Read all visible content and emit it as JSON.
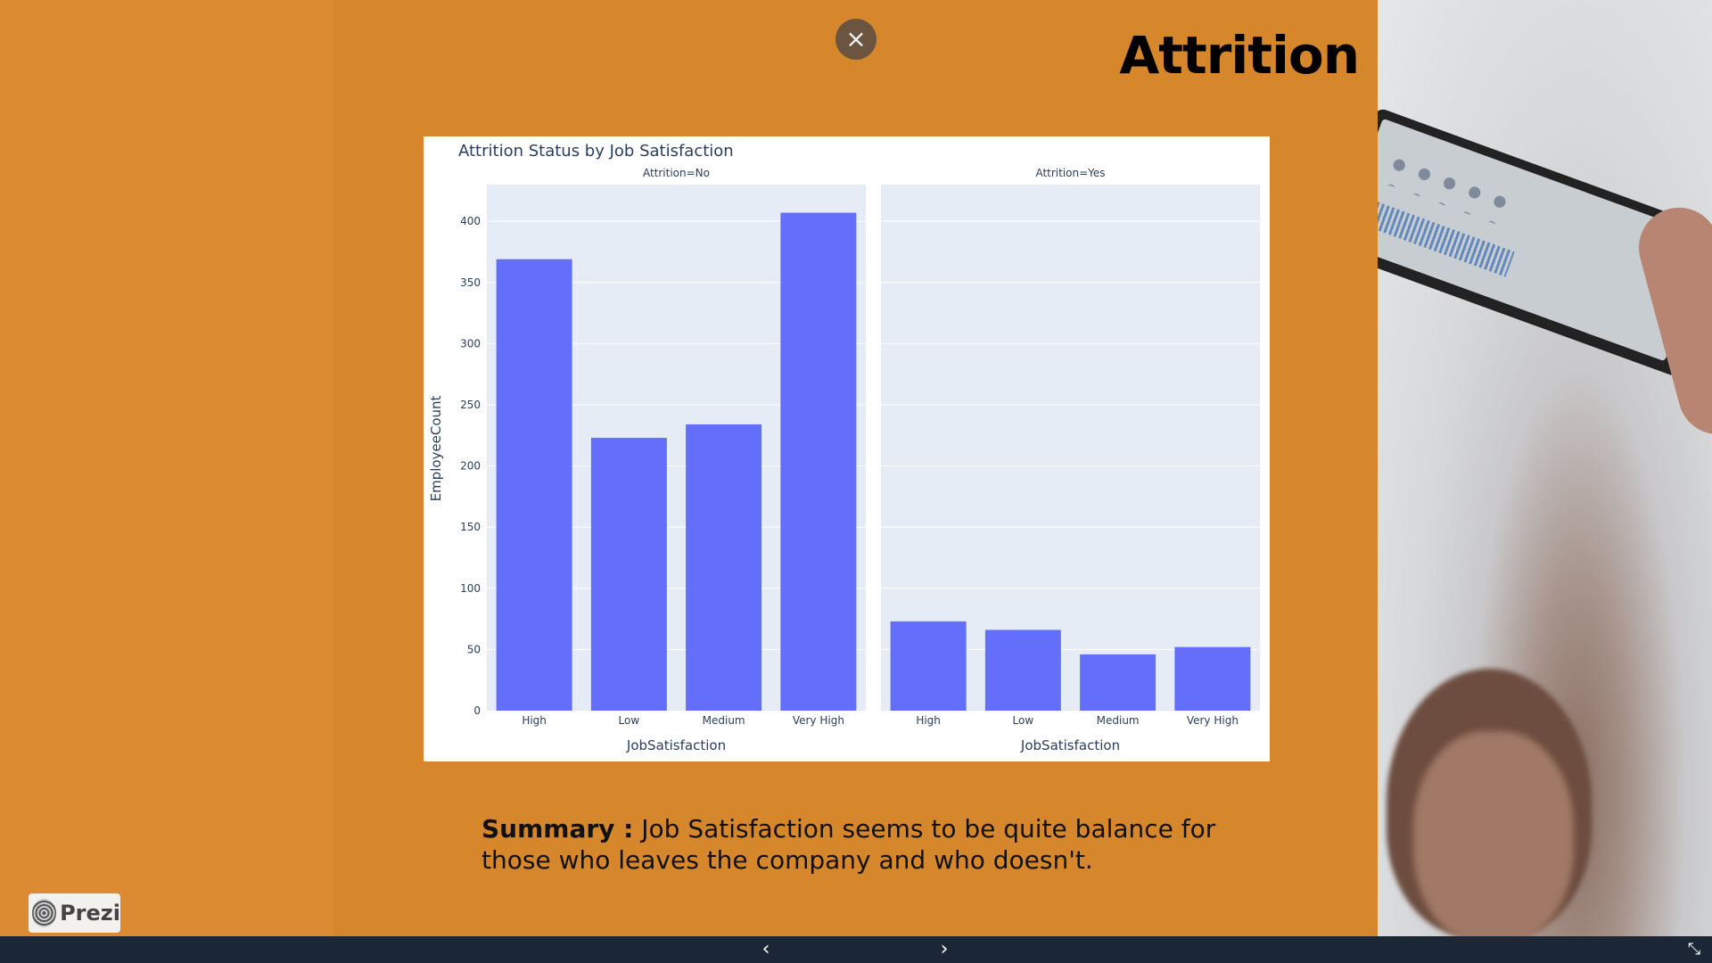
{
  "slide": {
    "title": "Attrition",
    "close_icon": "×",
    "summary_label": "Summary :",
    "summary_text": " Job Satisfaction seems to be quite balance for those who leaves the company and who doesn't."
  },
  "branding": {
    "prezi_label": "Prezi"
  },
  "nav": {
    "prev_icon": "‹",
    "next_icon": "›",
    "expand_icon": "⤡"
  },
  "colors": {
    "bar": "#636efa",
    "plot_bg": "#e5ecf6",
    "slide_bg": "#d6862b"
  },
  "chart_data": {
    "type": "bar",
    "title": "Attrition Status by Job Satisfaction",
    "ylabel": "EmployeeCount",
    "ylim": [
      0,
      430
    ],
    "yticks": [
      0,
      50,
      100,
      150,
      200,
      250,
      300,
      350,
      400
    ],
    "panels": [
      {
        "facet": "Attrition=No",
        "xlabel": "JobSatisfaction",
        "categories": [
          "High",
          "Low",
          "Medium",
          "Very High"
        ],
        "values": [
          369,
          223,
          234,
          407
        ]
      },
      {
        "facet": "Attrition=Yes",
        "xlabel": "JobSatisfaction",
        "categories": [
          "High",
          "Low",
          "Medium",
          "Very High"
        ],
        "values": [
          73,
          66,
          46,
          52
        ]
      }
    ]
  }
}
